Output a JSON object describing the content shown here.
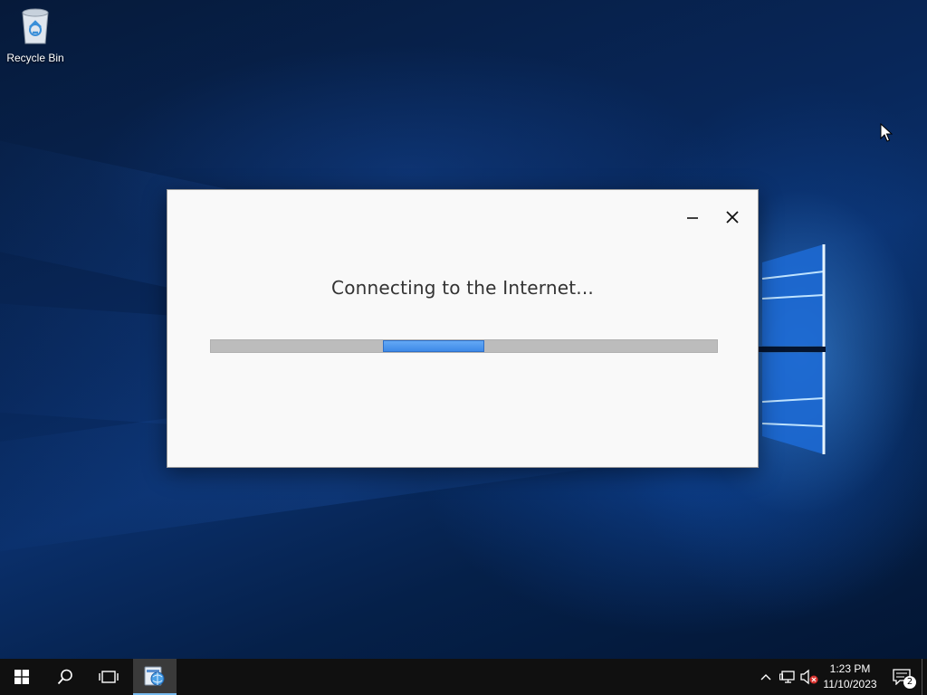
{
  "desktop": {
    "icons": [
      {
        "label": "Recycle Bin",
        "icon": "recycle-bin-icon"
      }
    ]
  },
  "dialog": {
    "title": "Connecting to the Internet...",
    "minimize_icon": "minimize-icon",
    "close_icon": "close-icon",
    "progress": {
      "type": "indeterminate",
      "segment_start": 0.34,
      "segment_end": 0.54,
      "fill_color": "#4a90e8",
      "track_color": "#bcbcbc"
    }
  },
  "taskbar": {
    "start_icon": "windows-start-icon",
    "search_icon": "search-icon",
    "task_view_icon": "task-view-icon",
    "pinned_app_icon": "setup-app-icon",
    "tray": {
      "chevron_icon": "chevron-up-icon",
      "network_icon": "network-icon",
      "volume_icon": "volume-muted-icon"
    },
    "time": "1:23 PM",
    "date": "11/10/2023",
    "notification_count": "2",
    "accent": "#76b9ed"
  }
}
